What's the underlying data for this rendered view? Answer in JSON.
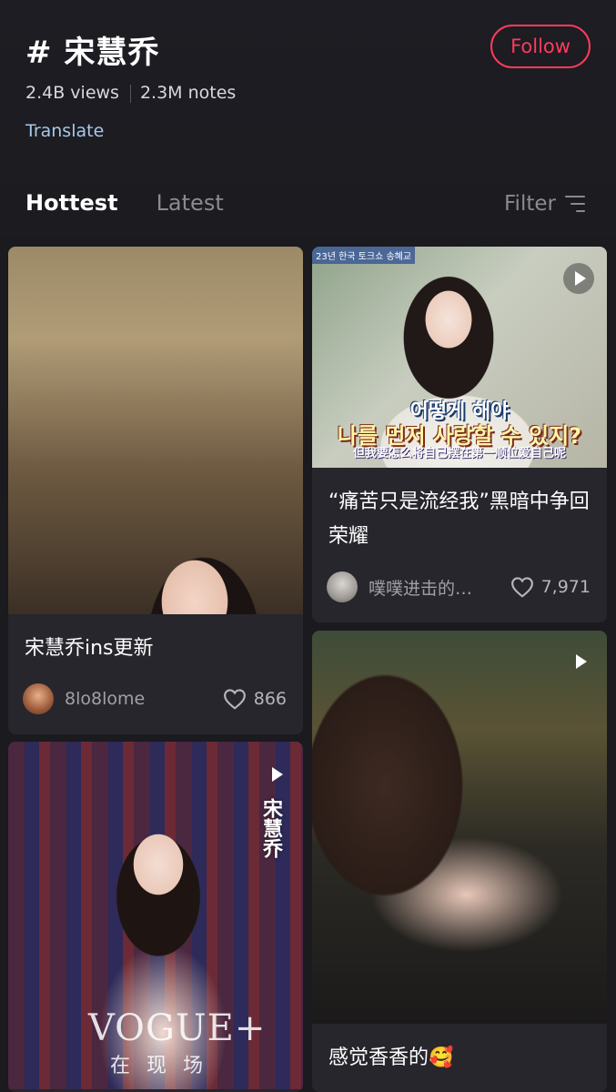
{
  "topic": {
    "title": "# 宋慧乔",
    "views": "2.4B views",
    "notes": "2.3M notes",
    "translate": "Translate",
    "follow": "Follow"
  },
  "tabs": [
    {
      "label": "Hottest"
    },
    {
      "label": "Latest"
    }
  ],
  "filter": {
    "label": "Filter",
    "icon": "filter-icon"
  },
  "colors": {
    "accent": "#ff3b5c",
    "background": "#1a1a1f",
    "card": "#26262c",
    "link": "#a8c9e8"
  },
  "posts": [
    {
      "caption": "宋慧乔ins更新",
      "author": "8lo8lome",
      "likes": "866",
      "type": "image"
    },
    {
      "caption": "“痛苦只是流经我”黑暗中争回荣耀",
      "author": "噗噗进击的…",
      "likes": "7,971",
      "type": "video",
      "overlay_korean_1": "어떻게 해야",
      "overlay_korean_2": "나를 먼저 사랑할 수 있지?",
      "overlay_chinese": "但我要怎么将自己摆在第一顺位爱自己呢",
      "overlay_chip": "23년 한국 토크쇼 송혜교"
    },
    {
      "caption": "感觉香香的🥰",
      "type": "video"
    },
    {
      "type": "video",
      "overlay_vertical": "宋慧乔",
      "overlay_brand": "VOGUE+",
      "overlay_brand_sub": "在现场"
    }
  ]
}
